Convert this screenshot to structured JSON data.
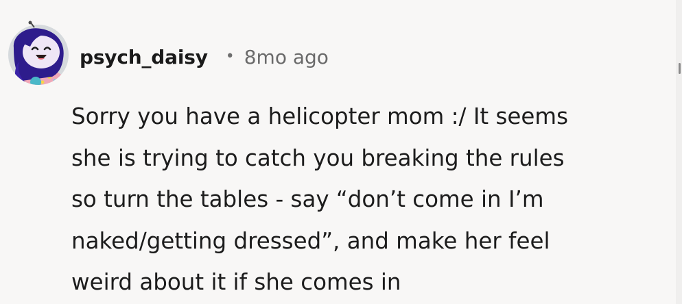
{
  "comment": {
    "username": "psych_daisy",
    "separator": "•",
    "timestamp": "8mo ago",
    "body_lines": [
      "Sorry you have a helicopter mom :/ It seems",
      "she is trying to catch you breaking the rules",
      "so turn the tables - say “don’t come in I’m",
      "naked/getting dressed”, and make her feel",
      "weird about it if she comes in"
    ],
    "avatar_icon": "snoo-avatar-icon"
  },
  "colors": {
    "background": "#f8f7f6",
    "text": "#1c1c1c",
    "meta": "#6a6a6a",
    "avatar_hair": "#3a1f8f",
    "avatar_face": "#ede4f6"
  }
}
